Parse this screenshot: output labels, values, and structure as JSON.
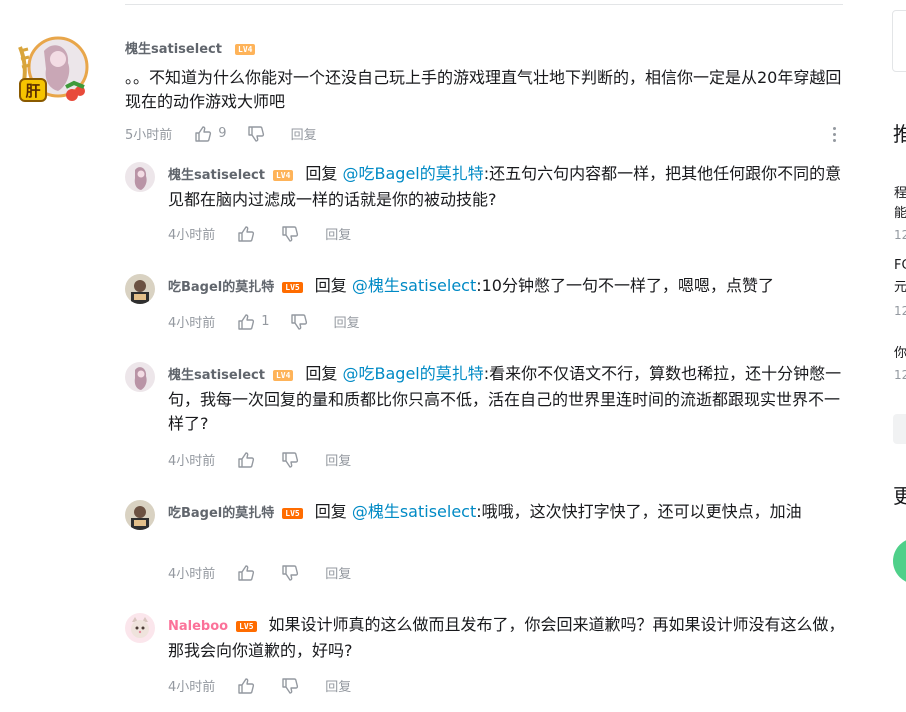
{
  "main_comment": {
    "username": "槐生satiselect",
    "level": "LV4",
    "text": "。。不知道为什么你能对一个还没自己玩上手的游戏理直气壮地下判断的，相信你一定是从20年穿越回现在的动作游戏大师吧",
    "time": "5小时前",
    "like_count": "9",
    "reply_label": "回复",
    "avatar_badge": "肝"
  },
  "replies": [
    {
      "username": "槐生satiselect",
      "level": "LV4",
      "reply_word": "回复",
      "mention": "@吃Bagel的莫扎特",
      "text": ":还五句六句内容都一样，把其他任何跟你不同的意见都在脑内过滤成一样的话就是你的被动技能?",
      "time": "4小时前",
      "like_count": "",
      "reply_label": "回复"
    },
    {
      "username": "吃Bagel的莫扎特",
      "level": "LV5",
      "reply_word": "回复",
      "mention": "@槐生satiselect",
      "text": ":10分钟憋了一句不一样了，嗯嗯，点赞了",
      "time": "4小时前",
      "like_count": "1",
      "reply_label": "回复"
    },
    {
      "username": "槐生satiselect",
      "level": "LV4",
      "reply_word": "回复",
      "mention": "@吃Bagel的莫扎特",
      "text": ":看来你不仅语文不行，算数也稀拉，还十分钟憋一句，我每一次回复的量和质都比你只高不低，活在自己的世界里连时间的流逝都跟现实世界不一样了?",
      "time": "4小时前",
      "like_count": "",
      "reply_label": "回复"
    },
    {
      "username": "吃Bagel的莫扎特",
      "level": "LV5",
      "reply_word": "回复",
      "mention": "@槐生satiselect",
      "text": ":哦哦，这次快打字快了，还可以更快点，加油",
      "time": "4小时前",
      "like_count": "",
      "reply_label": "回复"
    },
    {
      "username": "Naleboo",
      "level": "LV5",
      "reply_word": "",
      "mention": "",
      "text": "如果设计师真的这么做而且发布了，你会回来道歉吗？再如果设计师没有这么做，那我会向你道歉的，好吗?",
      "time": "4小时前",
      "like_count": "",
      "reply_label": "回复"
    }
  ],
  "right_panel": {
    "heading": "推",
    "item1_line1": "程",
    "item1_line2": "能",
    "item1_meta": "12",
    "item2_line1": "FC",
    "item2_line2": "元",
    "item2_meta": "12",
    "item3_line1": "你",
    "item3_meta": "12",
    "heading2": "更"
  },
  "colors": {
    "mention": "#008ac5",
    "lv4": "#feb359",
    "lv5": "#ff6c00",
    "vip_name": "#fb7299",
    "meta": "#9499a0"
  }
}
